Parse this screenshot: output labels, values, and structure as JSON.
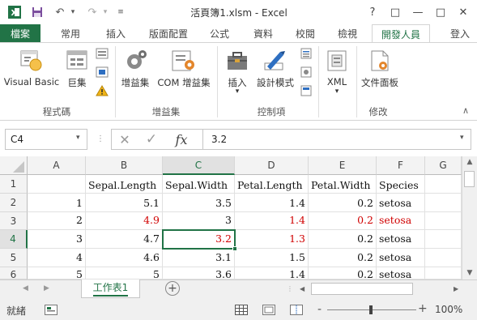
{
  "title_bar": {
    "title": "活頁簿1.xlsm - Excel",
    "help": "?",
    "restore": "□",
    "minimize": "—",
    "maximize": "□",
    "close": "✕"
  },
  "tabs": {
    "file": "檔案",
    "items": [
      "常用",
      "插入",
      "版面配置",
      "公式",
      "資料",
      "校閱",
      "檢視",
      "開發人員"
    ],
    "active": "開發人員",
    "sign_in": "登入"
  },
  "ribbon": {
    "code": {
      "group_label": "程式碼",
      "visual_basic": "Visual Basic",
      "macros": "巨集"
    },
    "addins": {
      "group_label": "增益集",
      "addins": "增益集",
      "com_addins": "COM 增益集"
    },
    "controls": {
      "group_label": "控制項",
      "insert": "插入",
      "design_mode": "設計模式"
    },
    "xml": {
      "label": "XML"
    },
    "modify": {
      "group_label": "修改",
      "document_panel": "文件面板"
    }
  },
  "formula_bar": {
    "name_box": "C4",
    "value": "3.2",
    "cancel": "✕",
    "enter": "✓",
    "fx": "fx"
  },
  "grid": {
    "columns": [
      "A",
      "B",
      "C",
      "D",
      "E",
      "F",
      "G"
    ],
    "rows": [
      {
        "num": "1",
        "cells": [
          "",
          "Sepal.Length",
          "Sepal.Width",
          "Petal.Length",
          "Petal.Width",
          "Species"
        ]
      },
      {
        "num": "2",
        "cells": [
          "1",
          "5.1",
          "3.5",
          "1.4",
          "0.2",
          "setosa"
        ]
      },
      {
        "num": "3",
        "cells": [
          "2",
          "4.9",
          "3",
          "1.4",
          "0.2",
          "setosa"
        ]
      },
      {
        "num": "4",
        "cells": [
          "3",
          "4.7",
          "3.2",
          "1.3",
          "0.2",
          "setosa"
        ]
      },
      {
        "num": "5",
        "cells": [
          "4",
          "4.6",
          "3.1",
          "1.5",
          "0.2",
          "setosa"
        ]
      },
      {
        "num": "6",
        "cells": [
          "5",
          "5",
          "3.6",
          "1.4",
          "0.2",
          "setosa"
        ]
      }
    ],
    "selected_cell": "C4",
    "highlight_color": "#d00000"
  },
  "sheets": {
    "tabs": [
      "工作表1"
    ],
    "active": "工作表1",
    "add": "+"
  },
  "status_bar": {
    "ready": "就緒",
    "zoom": "100%",
    "zoom_minus": "-",
    "zoom_plus": "+"
  },
  "colors": {
    "accent": "#217346",
    "red_text": "#d00000"
  }
}
